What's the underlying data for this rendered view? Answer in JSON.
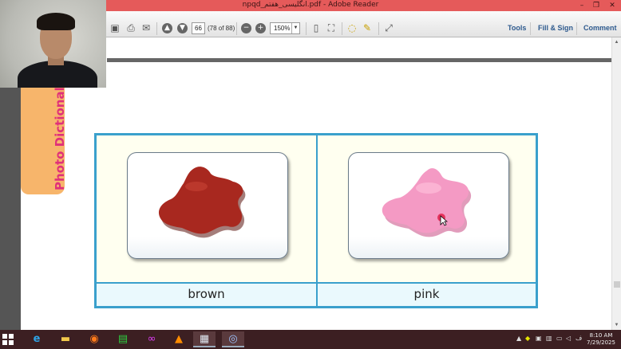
{
  "window": {
    "title": "npqd_انگلیسی_هفتم.pdf - Adobe Reader",
    "minimize_glyph": "–",
    "restore_glyph": "❐",
    "close_glyph": "✕"
  },
  "toolbar": {
    "page_number": "66",
    "page_count": "(78 of 88)",
    "zoom": "150%",
    "links": {
      "tools": "Tools",
      "fill_sign": "Fill & Sign",
      "comment": "Comment"
    }
  },
  "document": {
    "side_tab_label": "Photo Dictional",
    "items": [
      {
        "label": "brown",
        "color_hex": "#a8281f",
        "shadow_hex": "#5a120d",
        "highlight_hex": "#c84236"
      },
      {
        "label": "pink",
        "color_hex": "#f49ac4",
        "shadow_hex": "#c84a84",
        "highlight_hex": "#ffc4de"
      }
    ]
  },
  "taskbar": {
    "time": "8:10 AM",
    "date": "7/29/2025",
    "icons": [
      "windows-start-icon",
      "edge-icon",
      "file-explorer-icon",
      "firefox-icon",
      "store-icon",
      "app-icon",
      "vlc-icon",
      "adobe-reader-icon",
      "camera-app-icon"
    ]
  },
  "colors": {
    "accent_link": "#2e5a8e",
    "table_border": "#3aa0cc",
    "title_bar": "#e55a5a"
  }
}
